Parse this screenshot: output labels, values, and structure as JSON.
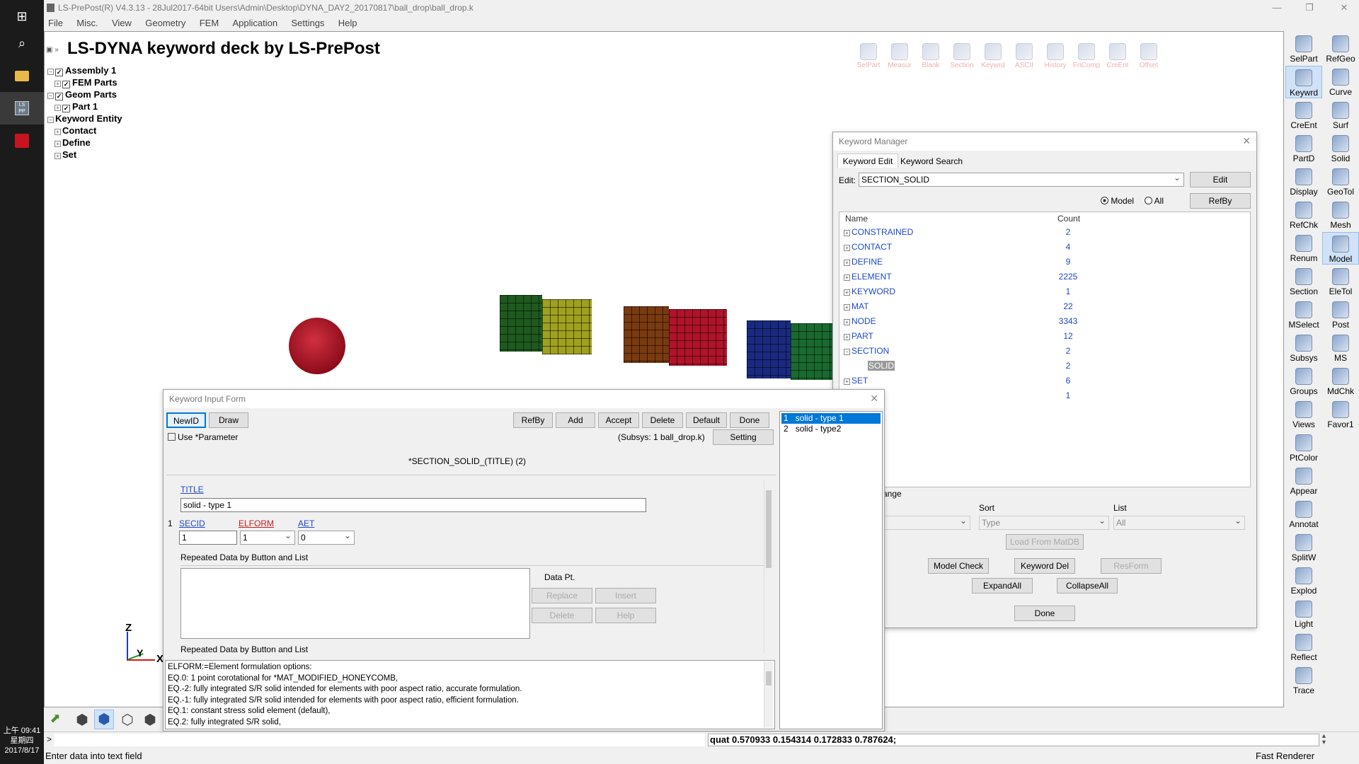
{
  "window": {
    "title": "LS-PrePost(R) V4.3.13 - 28Jul2017-64bit Users\\Admin\\Desktop\\DYNA_DAY2_20170817\\ball_drop\\ball_drop.k",
    "min": "—",
    "max": "❐",
    "close": "✕"
  },
  "menu": [
    "File",
    "Misc.",
    "View",
    "Geometry",
    "FEM",
    "Application",
    "Settings",
    "Help"
  ],
  "viewport": {
    "heading": "LS-DYNA keyword deck by LS-PrePost",
    "tree": [
      {
        "label": "Assembly 1"
      },
      {
        "label": "FEM Parts"
      },
      {
        "label": "Geom Parts"
      },
      {
        "label": "Part 1"
      },
      {
        "label": "Keyword Entity"
      },
      {
        "label": "Contact"
      },
      {
        "label": "Define"
      },
      {
        "label": "Set"
      }
    ],
    "tools": [
      "SelPart",
      "Measur",
      "Blank",
      "Section",
      "Keywrd",
      "ASCII",
      "History",
      "FriComp",
      "CreEnt",
      "Offset"
    ],
    "axis": {
      "z": "Z",
      "y": "Y",
      "x": "X"
    }
  },
  "right_panel": {
    "left_col": [
      "SelPart",
      "Keywrd",
      "CreEnt",
      "PartD",
      "Display",
      "RefChk",
      "Renum",
      "Section",
      "MSelect",
      "Subsys",
      "Groups",
      "Views",
      "PtColor",
      "Appear",
      "Annotat",
      "SplitW",
      "Explod",
      "Light",
      "Reflect",
      "Trace"
    ],
    "right_col": [
      "RefGeo",
      "Curve",
      "Surf",
      "Solid",
      "GeoTol",
      "Mesh",
      "Model",
      "EleTol",
      "Post",
      "MS",
      "MdChk",
      "Favor1"
    ]
  },
  "keyword_manager": {
    "title": "Keyword Manager",
    "tabs": [
      "Keyword Edit",
      "Keyword Search"
    ],
    "edit_label": "Edit:",
    "edit_value": "SECTION_SOLID",
    "edit_btn": "Edit",
    "radio_model": "Model",
    "radio_all": "All",
    "refby_btn": "RefBy",
    "col_name": "Name",
    "col_count": "Count",
    "rows": [
      {
        "name": "CONSTRAINED",
        "count": "2"
      },
      {
        "name": "CONTACT",
        "count": "4"
      },
      {
        "name": "DEFINE",
        "count": "9"
      },
      {
        "name": "ELEMENT",
        "count": "2225"
      },
      {
        "name": "KEYWORD",
        "count": "1"
      },
      {
        "name": "MAT",
        "count": "22"
      },
      {
        "name": "NODE",
        "count": "3343"
      },
      {
        "name": "PART",
        "count": "12"
      },
      {
        "name": "SECTION",
        "count": "2"
      },
      {
        "name": "SOLID",
        "count": "2"
      },
      {
        "name": "SET",
        "count": "6"
      },
      {
        "name": "",
        "count": "1"
      }
    ],
    "range_label": "ange",
    "sort_label": "Sort",
    "list_label": "List",
    "sort_value": "Type",
    "list_value": "All",
    "load_btn": "Load From MatDB",
    "model_check_btn": "Model Check",
    "keyword_del_btn": "Keyword Del",
    "resform_btn": "ResForm",
    "expand_btn": "ExpandAll",
    "collapse_btn": "CollapseAll",
    "done_btn": "Done"
  },
  "kif": {
    "title": "Keyword Input Form",
    "newid_btn": "NewID",
    "draw_btn": "Draw",
    "refby_btn": "RefBy",
    "add_btn": "Add",
    "accept_btn": "Accept",
    "delete_btn": "Delete",
    "default_btn": "Default",
    "done_btn": "Done",
    "use_param": "Use *Parameter",
    "subsys": "(Subsys: 1 ball_drop.k)",
    "setting_btn": "Setting",
    "heading": "*SECTION_SOLID_(TITLE)   (2)",
    "title_label": "TITLE",
    "title_value": "solid - type 1",
    "row_num": "1",
    "secid_label": "SECID",
    "elform_label": "ELFORM",
    "aet_label": "AET",
    "secid_value": "1",
    "elform_value": "1",
    "aet_value": "0",
    "repeated_label": "Repeated Data by Button and List",
    "data_pt": "Data Pt.",
    "replace_btn": "Replace",
    "insert_btn": "Insert",
    "delete2_btn": "Delete",
    "help_btn": "Help",
    "repeated_label2": "Repeated Data by Button and List",
    "help_lines": [
      "ELFORM:=Element formulation options:",
      "EQ.0: 1 point corotational for *MAT_MODIFIED_HONEYCOMB,",
      "EQ.-2: fully integrated S/R solid intended for elements with poor aspect ratio, accurate formulation.",
      "EQ.-1: fully integrated S/R solid intended for elements with poor aspect ratio, efficient formulation.",
      "EQ.1: constant stress solid element (default),",
      "EQ.2: fully integrated S/R solid,"
    ],
    "list_items": [
      {
        "num": "1",
        "label": "solid - type 1"
      },
      {
        "num": "2",
        "label": "solid - type2"
      }
    ]
  },
  "command": {
    "prompt": ">",
    "quat": "quat 0.570933 0.154314 0.172833 0.787624;"
  },
  "status": {
    "left": "Enter data into text field",
    "right": "Fast Renderer"
  },
  "clock": {
    "time": "上午 09:41",
    "day": "星期四",
    "date": "2017/8/17"
  }
}
